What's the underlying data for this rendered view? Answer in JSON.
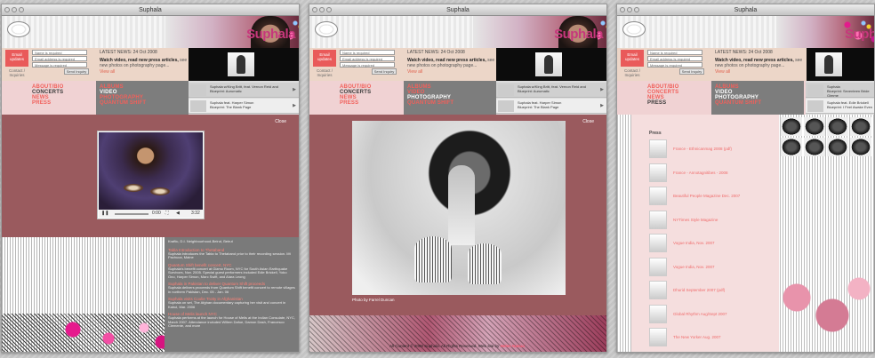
{
  "window_title": "Suphala",
  "brand": "Suphala",
  "signup": {
    "label": "Email updates",
    "contact": "Contact / Inquiries"
  },
  "form": {
    "name": "Name is required",
    "email": "Email address is required",
    "message": "Message is required",
    "send": "Send Inquiry"
  },
  "news": {
    "date": "LATEST NEWS: 24 Oct 2008",
    "body_bold": "Watch video, read new press articles,",
    "body_rest": " see new photos on photography page...",
    "link": "View all"
  },
  "nav": {
    "col1": [
      "ABOUT/BIO",
      "CONCERTS",
      "NEWS",
      "PRESS"
    ],
    "col2": [
      "ALBUMS",
      "VIDEO",
      "PHOTOGRAPHY",
      "QUANTUM SHIFT"
    ]
  },
  "tracks": [
    {
      "title": "Suphala w/King Britt, feat. Vernon Reid and",
      "album": "Blueprint: Aurumatic"
    },
    {
      "title": "Suphala feat. Harper Simon",
      "album": "Blueprint: The Blank Page"
    }
  ],
  "tracks_w3": [
    {
      "title": "Suphala",
      "album": "Blueprint: Seventeen Bride Gimme"
    },
    {
      "title": "Suphala feat. Edie Brickell",
      "album": "Blueprint: I Feel Awake Even"
    }
  ],
  "video_overlay": {
    "close": "Close",
    "player_time": "0:00",
    "time_total": "3:32"
  },
  "list_intro": "Kraftic, D.I. Neighbourhood-Beirut, Beirut",
  "list": [
    {
      "h": "Tabla Introduction to Thetaband",
      "d": "Suphala introduces the Tabla to Thetaband prior to their recording session. Mt Pachuca, Maine"
    },
    {
      "h": "Quantum Shift benefit concert, NYC",
      "d": "Suphala's benefit concert at Gizmo Room, NYC for South Asian Earthquake Survivors, Nov. 2005. Special guest performers included Edie Brickell, Yoko Ono, Harper Simon, Marc Swift, and Alara Leong"
    },
    {
      "h": "Suphala in Pakistan to deliver Quantum Shift proceeds",
      "d": "Suphala delivers proceeds from Quantum Shift benefit concert to remote villages in northern Pakistan, Dec. 05 - Jan. 06"
    },
    {
      "h": "Suphala visits Coolie Trotty in Afghanistan",
      "d": "Suphala on set, The Afghan documentary capturing her visit and concert in Kabul, Mar. 2006"
    },
    {
      "h": "House of Melis launch NYC",
      "d": "Suphala performs at the launch for House of Melis at the Indian Consulate, NYC, March 2007. Attendance included Willem Dafoe, Damon Dash, Francesco Clemente, and more"
    }
  ],
  "photo_credit": "Photo by Farrel Duncan",
  "footer": {
    "copy": "All Content © 2008 Suphala. All Rights Reserved. Web site by",
    "designer": "Helen Natsui"
  },
  "press": {
    "heading": "Press",
    "items": [
      "France - Ethnicanmag 2008 (pdf)",
      "France - Annotagnitibes - 2008",
      "Beautiful People Magazine Dec. 2007",
      "NYTimes Style Magazine",
      "Vogue India, Nov. 2007",
      "Vogue India, Nov. 2007",
      "Dhurid September 2007 (pdf)",
      "Global Rhythm Aug/Sept 2007",
      "The New Yorker Aug. 2007"
    ]
  }
}
